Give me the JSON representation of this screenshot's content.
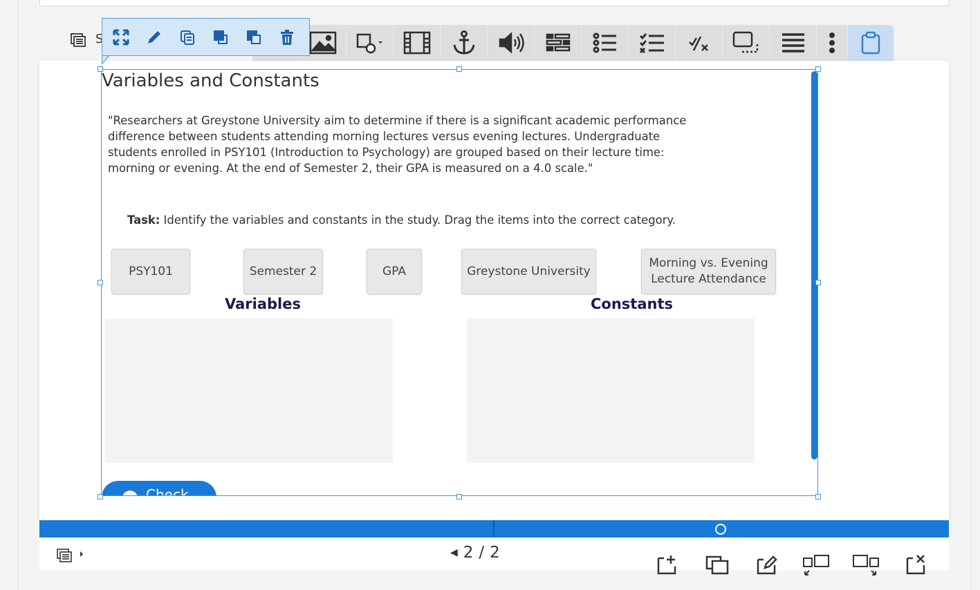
{
  "top_left_letter": "S",
  "toolbar": {
    "icons": [
      "link-icon",
      "image-icon",
      "shape-icon",
      "video-icon",
      "anchor-icon",
      "audio-icon",
      "form-icon",
      "bullet-list-icon",
      "checklist-icon",
      "math-icon",
      "tooltip-icon",
      "text-list-icon",
      "more-icon",
      "clipboard-icon"
    ],
    "active_index": 13
  },
  "mini_toolbar": {
    "icons": [
      "expand-icon",
      "edit-icon",
      "duplicate-icon",
      "bring-front-icon",
      "send-back-icon",
      "delete-icon"
    ]
  },
  "slide": {
    "title": "Variables and Constants",
    "quote": "\"Researchers at Greystone University aim to determine if there is a significant academic performance difference between students attending morning lectures versus evening lectures. Undergraduate students enrolled in PSY101 (Introduction to Psychology) are grouped based on their lecture time: morning or evening. At the end of Semester 2, their GPA is measured on a 4.0 scale.\"",
    "task_label": "Task:",
    "task_text": " Identify the variables and constants in the study. Drag the items into the correct category.",
    "items": [
      "PSY101",
      "Semester 2",
      "GPA",
      "Greystone University",
      "Morning vs. Evening\nLecture Attendance"
    ],
    "categories": [
      "Variables",
      "Constants"
    ],
    "check_label": "Check"
  },
  "pager": {
    "current": "2",
    "separator": "/",
    "total": "2"
  },
  "bottom_tools": [
    "add-slide-icon",
    "duplicate-slide-icon",
    "edit-slide-icon",
    "move-slide-left-icon",
    "move-slide-right-icon",
    "delete-slide-icon"
  ],
  "colors": {
    "accent": "#1a7ad8",
    "heading": "#1a1a4e",
    "selection": "#4a90d9"
  }
}
